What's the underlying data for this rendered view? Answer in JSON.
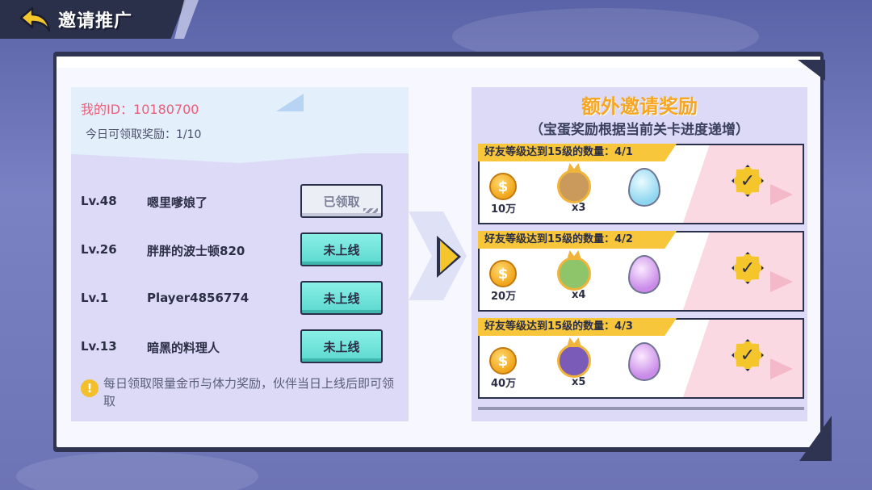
{
  "header": {
    "title": "邀请推广"
  },
  "left": {
    "my_id_label": "我的ID：10180700",
    "today_label": "今日可领取奖励：1/10",
    "friends": [
      {
        "level": "Lv.48",
        "name": "嗯里嗲娘了",
        "status": "已领取",
        "state": "claimed"
      },
      {
        "level": "Lv.26",
        "name": "胖胖的波士顿820",
        "status": "未上线",
        "state": "offline"
      },
      {
        "level": "Lv.1",
        "name": "Player4856774",
        "status": "未上线",
        "state": "offline"
      },
      {
        "level": "Lv.13",
        "name": "暗黑的料理人",
        "status": "未上线",
        "state": "offline"
      }
    ],
    "tip": "每日领取限量金币与体力奖励，伙伴当日上线后即可领取"
  },
  "right": {
    "title": "额外邀请奖励",
    "subtitle": "（宝蛋奖励根据当前关卡进度递增）",
    "rewards": [
      {
        "requirement": "好友等级达到15级的数量：4/1",
        "coins": "10万",
        "hero_count": "x3",
        "egg": "blue",
        "completed": true
      },
      {
        "requirement": "好友等级达到15级的数量：4/2",
        "coins": "20万",
        "hero_count": "x4",
        "egg": "purple",
        "completed": true
      },
      {
        "requirement": "好友等级达到15级的数量：4/3",
        "coins": "40万",
        "hero_count": "x5",
        "egg": "purple",
        "completed": true
      }
    ]
  },
  "icons": {
    "back": "back-arrow-icon",
    "coin": "coin-icon",
    "check": "check-badge-icon",
    "info": "info-icon"
  },
  "colors": {
    "accent_yellow": "#f5c62b",
    "teal_button": "#5bd8cf",
    "id_pink": "#ec5d79",
    "title_orange": "#f5a623"
  }
}
